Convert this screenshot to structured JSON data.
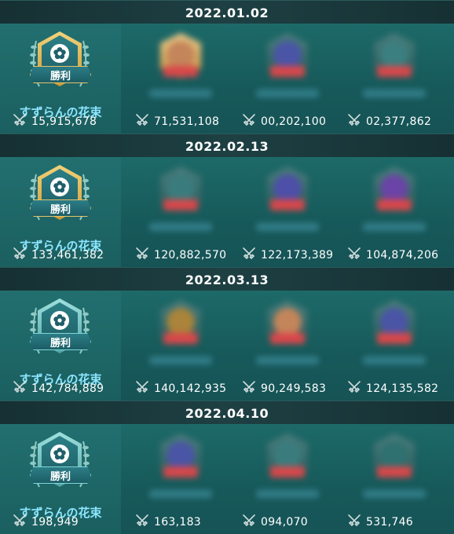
{
  "colors": {
    "accent_team": "#8ce6ff",
    "score": "#ffffff",
    "gold": "#d8ad4c",
    "teal": "#6cc6c4",
    "blur_red": "#d9474a"
  },
  "icons": {
    "sword": "crossed-swords-icon",
    "flower": "flower-icon"
  },
  "battles": [
    {
      "date": "2022.01.02",
      "emblem_style": "gold",
      "team": {
        "name": "すずらんの花束",
        "result": "勝利",
        "score": "15,915,678"
      },
      "opponents": [
        {
          "score": "71,531,108",
          "tint": "#c4855a"
        },
        {
          "score": "00,202,100",
          "tint": "#4a55a6"
        },
        {
          "score": "02,377,862",
          "tint": "#3c7f80"
        }
      ]
    },
    {
      "date": "2022.02.13",
      "emblem_style": "gold",
      "team": {
        "name": "すずらんの花束",
        "result": "勝利",
        "score": "133,461,382"
      },
      "opponents": [
        {
          "score": "120,882,570",
          "tint": "#3a7c7e"
        },
        {
          "score": "122,173,389",
          "tint": "#4d4fa8"
        },
        {
          "score": "104,874,206",
          "tint": "#6a44a6"
        }
      ]
    },
    {
      "date": "2022.03.13",
      "emblem_style": "teal",
      "team": {
        "name": "すずらんの花束",
        "result": "勝利",
        "score": "142,784,889"
      },
      "opponents": [
        {
          "score": "140,142,935",
          "tint": "#a9843a"
        },
        {
          "score": "90,249,583",
          "tint": "#c4855a"
        },
        {
          "score": "124,135,582",
          "tint": "#4a55a6"
        }
      ]
    },
    {
      "date": "2022.04.10",
      "emblem_style": "teal",
      "team": {
        "name": "すずらんの花束",
        "result": "勝利",
        "score": "198,949"
      },
      "opponents": [
        {
          "score": "163,183",
          "tint": "#4a55a6"
        },
        {
          "score": "094,070",
          "tint": "#3a7c7e"
        },
        {
          "score": "531,746",
          "tint": "#2f7070"
        }
      ]
    }
  ]
}
